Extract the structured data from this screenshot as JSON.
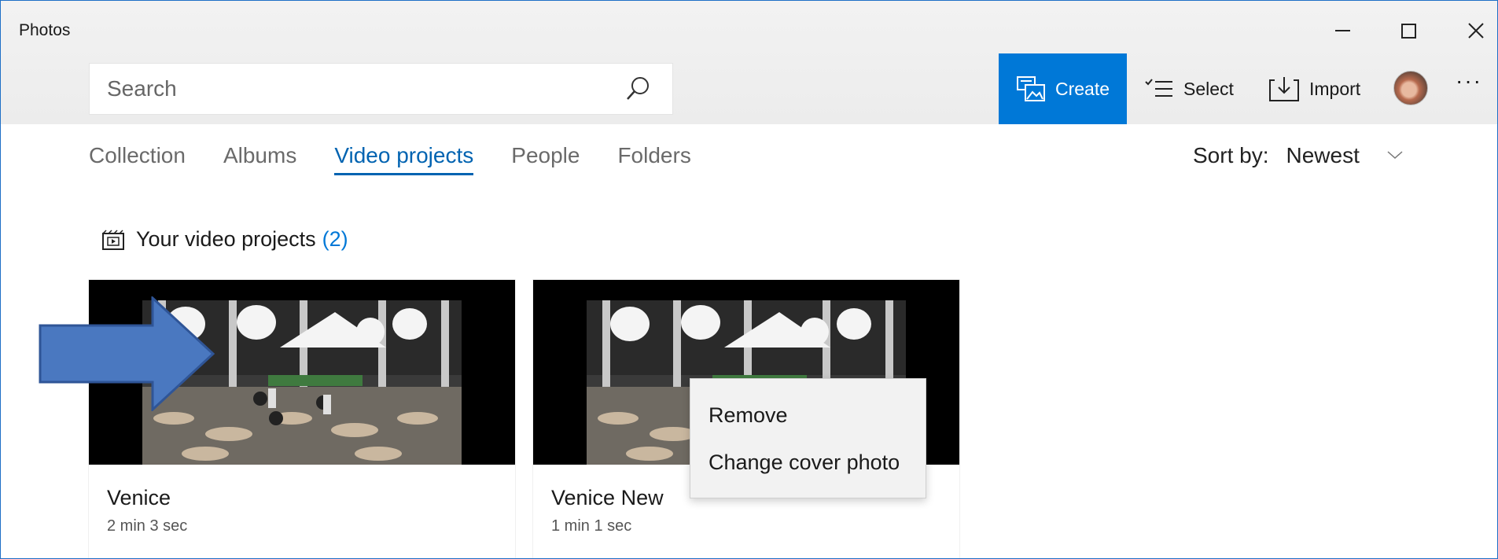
{
  "window": {
    "title": "Photos"
  },
  "search": {
    "placeholder": "Search"
  },
  "toolbar": {
    "create_label": "Create",
    "select_label": "Select",
    "import_label": "Import",
    "more_label": "···"
  },
  "tabs": [
    {
      "label": "Collection",
      "active": false
    },
    {
      "label": "Albums",
      "active": false
    },
    {
      "label": "Video projects",
      "active": true
    },
    {
      "label": "People",
      "active": false
    },
    {
      "label": "Folders",
      "active": false
    }
  ],
  "sort": {
    "label": "Sort by:",
    "value": "Newest"
  },
  "projects": {
    "heading": "Your video projects",
    "count": "(2)",
    "items": [
      {
        "title": "Venice",
        "duration": "2 min 3 sec"
      },
      {
        "title": "Venice New",
        "duration": "1 min 1 sec"
      }
    ]
  },
  "context_menu": {
    "items": [
      "Remove",
      "Change cover photo"
    ]
  },
  "colors": {
    "accent": "#0078d7",
    "active_tab": "#0063b1",
    "arrow": "#4a78c0"
  },
  "icons": [
    "search-icon",
    "create-icon",
    "select-icon",
    "import-icon",
    "video-project-icon",
    "chevron-down-icon"
  ]
}
